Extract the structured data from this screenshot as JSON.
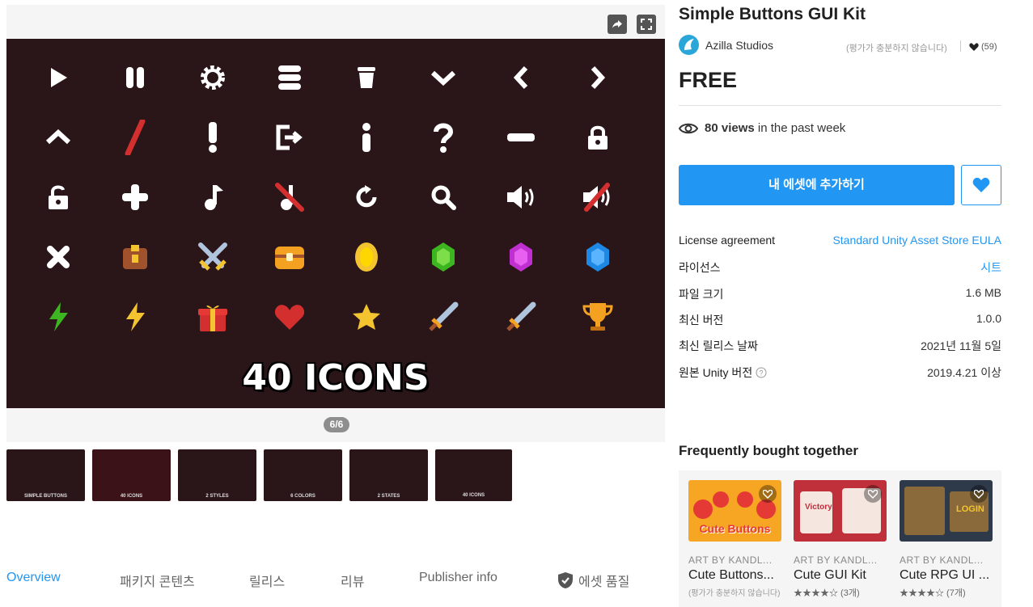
{
  "gallery": {
    "counter": "6/6",
    "caption": "40 ICONS",
    "thumbnails": [
      "SIMPLE BUTTONS",
      "40 ICONS",
      "2 STYLES",
      "6 COLORS",
      "2 STATES",
      "40 ICONS"
    ]
  },
  "tabs": [
    "Overview",
    "패키지 콘텐츠",
    "릴리스",
    "리뷰",
    "Publisher info",
    "에셋 품질"
  ],
  "product": {
    "title": "Simple Buttons GUI Kit",
    "publisher": "Azilla Studios",
    "rating_note": "(평가가 충분하지 않습니다)",
    "favorites": "(59)",
    "price": "FREE",
    "views_count": "80 views",
    "views_suffix": " in the past week",
    "add_button": "내 에셋에 추가하기"
  },
  "info": [
    {
      "label": "License agreement",
      "value": "Standard Unity Asset Store EULA"
    },
    {
      "label": "라이선스",
      "value": "시트"
    },
    {
      "label": "파일 크기",
      "value": "1.6 MB"
    },
    {
      "label": "최신 버전",
      "value": "1.0.0"
    },
    {
      "label": "최신 릴리스 날짜",
      "value": "2021년 11월 5일"
    },
    {
      "label": "원본 Unity 버전",
      "value": "2019.4.21 이상"
    }
  ],
  "fbt": {
    "title": "Frequently bought together",
    "cards": [
      {
        "by": "ART BY KANDL...",
        "name": "Cute Buttons...",
        "rating": "(평가가 충분하지 않습니다)",
        "img_text": "Cute Buttons"
      },
      {
        "by": "ART BY KANDL...",
        "name": "Cute GUI Kit",
        "rating": "★★★★☆ (3개)",
        "img_text": "Victory"
      },
      {
        "by": "ART BY KANDL...",
        "name": "Cute RPG UI ...",
        "rating": "★★★★☆ (7개)",
        "img_text": "LOGIN"
      }
    ]
  },
  "colors": {
    "accent": "#2196f3",
    "hero_bg": "#2a1518"
  }
}
